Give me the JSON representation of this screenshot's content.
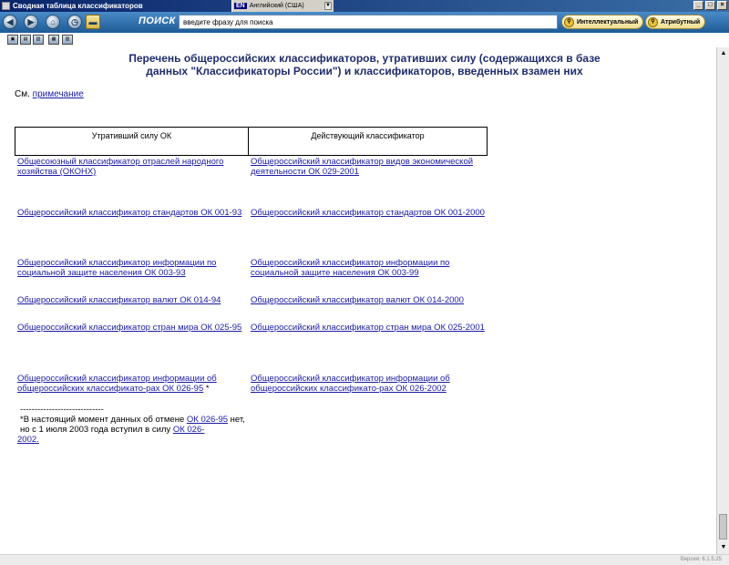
{
  "window": {
    "title": "Сводная таблица классификаторов",
    "language_code": "EN",
    "language_name": "Английский (США)"
  },
  "toolbar": {
    "search_label": "ПОИСК",
    "search_value": "введите фразу для поиска",
    "intellectual_button": "Интеллектуальный",
    "attribute_button": "Атрибутный"
  },
  "content": {
    "heading": "Перечень общероссийских классификаторов, утративших силу (содержащихся в базе данных \"Классификаторы России\") и классификаторов, введенных взамен них",
    "see_prefix": "См.",
    "see_link": "примечание",
    "columns": {
      "obsolete": "Утративший силу ОК",
      "current": "Действующий классификатор"
    },
    "rows": [
      {
        "obsolete": "Общесоюзный классификатор отраслей народного хозяйства (ОКОНХ)",
        "current": "Общероссийский классификатор видов экономической деятельности ОК 029-2001"
      },
      {
        "obsolete": "Общероссийский классификатор стандартов ОК 001-93",
        "current": "Общероссийский классификатор стандартов ОК 001-2000"
      },
      {
        "obsolete": "Общероссийский классификатор информации по социальной защите населения ОК 003-93",
        "current": "Общероссийский классификатор информации по социальной защите населения ОК 003-99"
      },
      {
        "obsolete": "Общероссийский классификатор валют ОК 014-94",
        "current": "Общероссийский классификатор валют ОК 014-2000"
      },
      {
        "obsolete": "Общероссийский классификатор стран мира ОК 025-95",
        "current": "Общероссийский классификатор стран мира ОК 025-2001"
      },
      {
        "obsolete": "Общероссийский классификатор информации об общероссийских классификато-рах ОК 026-95",
        "current": "Общероссийский классификатор информации об общероссийских классификато-рах ОК 026-2002"
      }
    ],
    "star": "*",
    "separator": "-----------------------------",
    "footnote_text_1": "*В настоящий момент данных об отмене",
    "footnote_link_1": "ОК 026-95",
    "footnote_text_2": "нет, но с 1 июля 2003 года вступил в силу",
    "footnote_link_2": "ОК 026-",
    "footnote_link_3": "2002."
  },
  "status": {
    "version": "Версия: 6.1.5.25"
  }
}
